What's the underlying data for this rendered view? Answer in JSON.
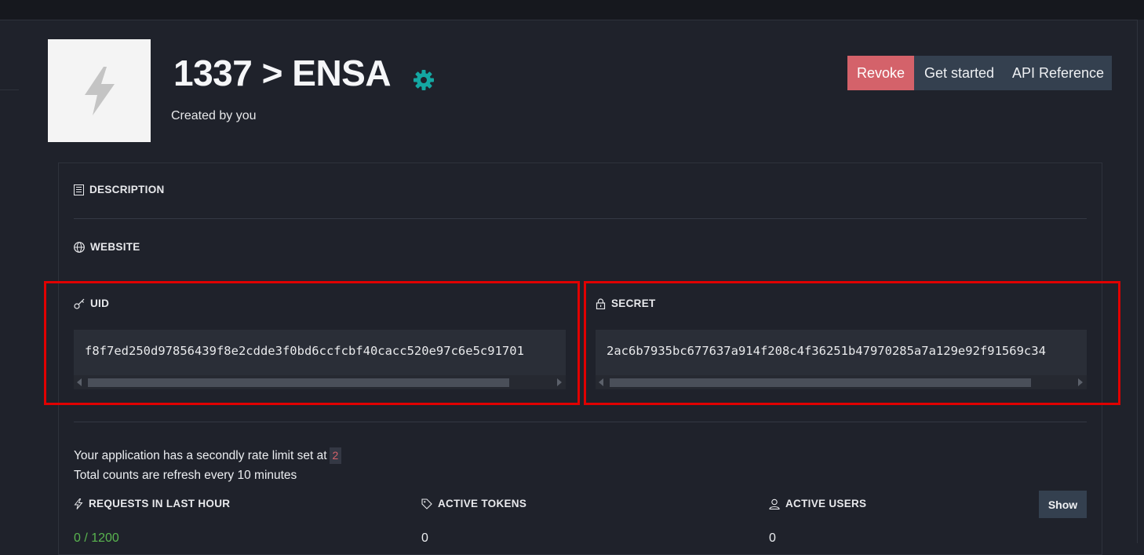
{
  "app": {
    "title": "1337 > ENSA",
    "created_by": "Created by you",
    "logo_icon": "lightning-icon",
    "settings_icon": "gear-icon",
    "accent_color": "#14a7a2"
  },
  "actions": {
    "revoke": "Revoke",
    "get_started": "Get started",
    "api_reference": "API Reference",
    "revoke_color": "#d4626a"
  },
  "sections": {
    "description": "DESCRIPTION",
    "website": "WEBSITE",
    "uid": "UID",
    "secret": "SECRET"
  },
  "credentials": {
    "uid_value": "f8f7ed250d97856439f8e2cdde3f0bd6ccfcbf40cacc520e97c6e5c91701",
    "secret_value": "2ac6b7935bc677637a914f208c4f36251b47970285a7a129e92f91569c34"
  },
  "rate_limit": {
    "text": "Your application has a secondly rate limit set at",
    "value": "2",
    "refresh_note": "Total counts are refresh every 10 minutes"
  },
  "stats": {
    "requests_label": "REQUESTS IN LAST HOUR",
    "requests_value": "0 / 1200",
    "tokens_label": "ACTIVE TOKENS",
    "tokens_value": "0",
    "users_label": "ACTIVE USERS",
    "users_value": "0",
    "show_button": "Show"
  }
}
